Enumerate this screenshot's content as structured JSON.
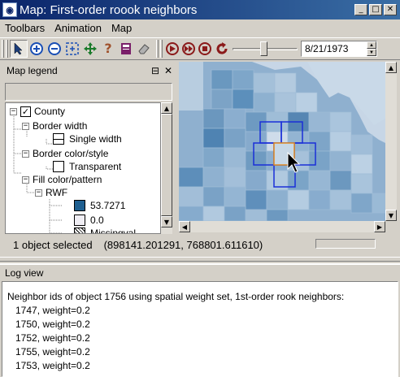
{
  "window": {
    "title": "Map: First-order roook neighbors",
    "icon": "globe-icon"
  },
  "menu": {
    "items": [
      "Toolbars",
      "Animation",
      "Map"
    ]
  },
  "toolbar": {
    "tools": [
      "select-arrow-icon",
      "zoom-in-icon",
      "zoom-out-icon",
      "zoom-extent-icon",
      "pan-icon",
      "help-icon",
      "legend-book-icon",
      "eraser-icon"
    ],
    "date": "8/21/1973"
  },
  "legend": {
    "title": "Map legend",
    "items": {
      "county": "County",
      "border_width": "Border width",
      "single_width": "Single width",
      "border_color": "Border color/style",
      "transparent": "Transparent",
      "fill": "Fill color/pattern",
      "rwf": "RWF",
      "val_high": "53.7271",
      "val_zero": "0.0",
      "missing": "Missingval"
    },
    "colors": {
      "high": "#1e5f90",
      "zero": "#f0eef4"
    }
  },
  "status": {
    "selected": "1 object selected",
    "coords": "(898141.201291, 768801.611610)"
  },
  "log": {
    "title": "Log view",
    "header": "Neighbor ids of object 1756 using spatial weight set, 1st-order rook neighbors:",
    "lines": [
      "1747, weight=0.2",
      "1750, weight=0.2",
      "1752, weight=0.2",
      "1755, weight=0.2",
      "1753, weight=0.2"
    ]
  }
}
